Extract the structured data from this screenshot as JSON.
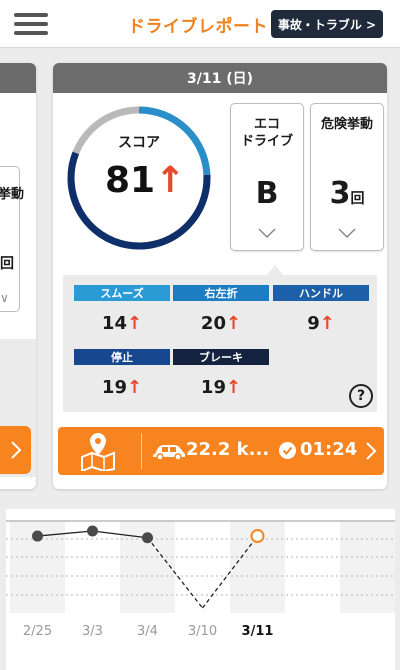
{
  "header": {
    "title": "ドライブレポート",
    "trouble_button": "事故・トラブル >"
  },
  "report": {
    "date": "3/11 (日)",
    "score_label": "スコア",
    "score_value": "81",
    "trend_arrow": "↑",
    "eco_title_line1": "エコ",
    "eco_title_line2": "ドライブ",
    "eco_grade": "B",
    "risk_title": "危険挙動",
    "risk_count": "3",
    "risk_unit": "回"
  },
  "metrics": [
    {
      "label": "スムーズ",
      "value": "14",
      "color": "#2b9bd6"
    },
    {
      "label": "右左折",
      "value": "20",
      "color": "#1d7dc2"
    },
    {
      "label": "ハンドル",
      "value": "9",
      "color": "#1d5fa8"
    },
    {
      "label": "停止",
      "value": "19",
      "color": "#17488f"
    },
    {
      "label": "ブレーキ",
      "value": "19",
      "color": "#14233f"
    }
  ],
  "help_icon": "?",
  "trip": {
    "distance": "22.2 k...",
    "duration": "01:24"
  },
  "side_card": {
    "partial_title": "挙動",
    "partial_value": "回"
  },
  "colors": {
    "accent_orange": "#f7841f",
    "header_orange": "#f0821e",
    "score_ring_light": "#2a8fc9",
    "score_ring_dark": "#0f2f6b",
    "arrow_red": "#e64a2e"
  },
  "chart_data": {
    "type": "line",
    "categories": [
      "2/25",
      "3/3",
      "3/4",
      "3/10",
      "3/11"
    ],
    "values": [
      81,
      84,
      80,
      38,
      81
    ],
    "ylim": [
      35,
      90
    ],
    "grid": true,
    "missing_segment_dashed": true,
    "highlight_index": 4
  }
}
